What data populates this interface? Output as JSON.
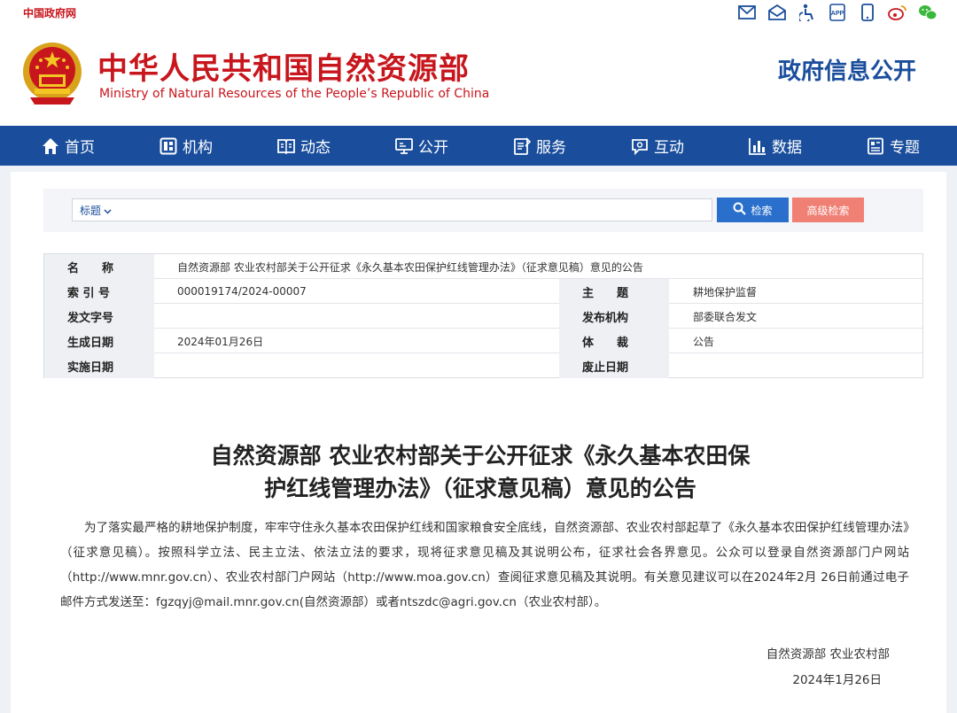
{
  "topbar": {
    "gov_link": "中国政府网",
    "icons": [
      "mail-icon",
      "open-mail-icon",
      "accessibility-icon",
      "app-icon",
      "mobile-icon",
      "weibo-icon",
      "wechat-icon"
    ]
  },
  "header": {
    "title_cn": "中华人民共和国自然资源部",
    "title_en": "Ministry of Natural Resources of the People’s Republic of China",
    "section": "政府信息公开"
  },
  "nav": {
    "items": [
      {
        "label": "首页",
        "icon": "home-icon"
      },
      {
        "label": "机构",
        "icon": "org-icon"
      },
      {
        "label": "动态",
        "icon": "news-icon"
      },
      {
        "label": "公开",
        "icon": "disclosure-icon"
      },
      {
        "label": "服务",
        "icon": "service-icon"
      },
      {
        "label": "互动",
        "icon": "chat-icon"
      },
      {
        "label": "数据",
        "icon": "chart-icon"
      },
      {
        "label": "专题",
        "icon": "topic-icon"
      }
    ]
  },
  "search": {
    "field_select": "标题",
    "query": "",
    "search_label": "检索",
    "advanced_label": "高级检索"
  },
  "meta": {
    "name_label": "名　　称",
    "name_value": "自然资源部 农业农村部关于公开征求《永久基本农田保护红线管理办法》（征求意见稿）意见的公告",
    "index_label": "索 引 号",
    "index_value": "000019174/2024-00007",
    "subject_label": "主　　题",
    "subject_value": "耕地保护监督",
    "doc_no_label": "发文字号",
    "doc_no_value": "",
    "issuer_label": "发布机构",
    "issuer_value": "部委联合发文",
    "created_label": "生成日期",
    "created_value": "2024年01月26日",
    "genre_label": "体　　裁",
    "genre_value": "公告",
    "effective_label": "实施日期",
    "effective_value": "",
    "expiry_label": "废止日期",
    "expiry_value": ""
  },
  "article": {
    "title_line1": "自然资源部 农业农村部关于公开征求《永久基本农田保",
    "title_line2": "护红线管理办法》（征求意见稿）意见的公告",
    "body": "为了落实最严格的耕地保护制度，牢牢守住永久基本农田保护红线和国家粮食安全底线，自然资源部、农业农村部起草了《永久基本农田保护红线管理办法》（征求意见稿）。按照科学立法、民主立法、依法立法的要求，现将征求意见稿及其说明公布，征求社会各界意见。公众可以登录自然资源部门户网站（http://www.mnr.gov.cn）、农业农村部门户网站（http://www.moa.gov.cn）查阅征求意见稿及其说明。有关意见建议可以在2024年2月 26日前通过电子邮件方式发送至：fgzqyj@mail.mnr.gov.cn(自然资源部）或者ntszdc@agri.gov.cn（农业农村部）。",
    "signature": "自然资源部  农业农村部",
    "date": "2024年1月26日"
  },
  "colors": {
    "brand_red": "#c8161d",
    "nav_blue": "#1a4e9c",
    "search_blue": "#2a6fcb",
    "advanced_salmon": "#f07f74"
  }
}
